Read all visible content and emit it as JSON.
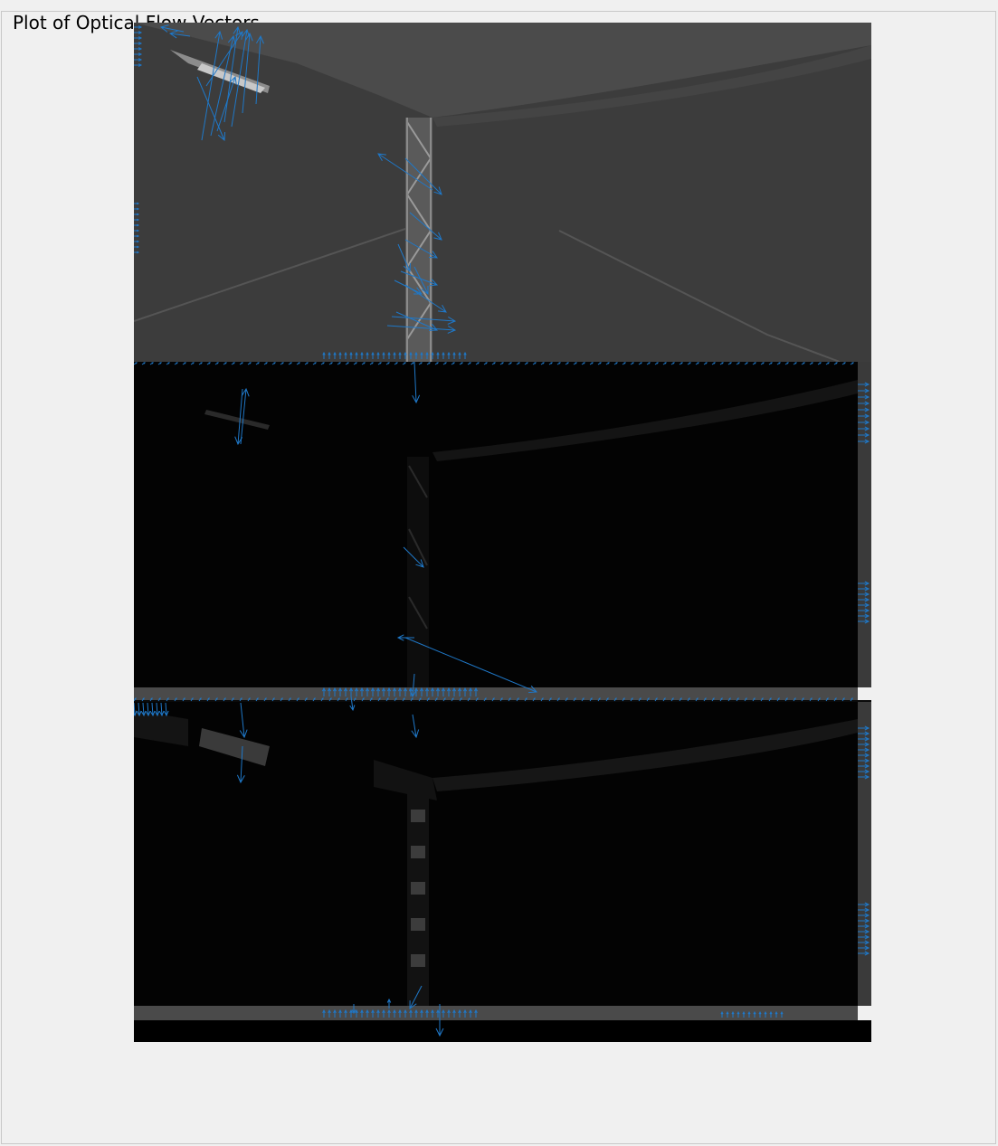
{
  "panel": {
    "title": "Plot of Optical Flow Vectors"
  },
  "colors": {
    "vector": "#1f78c8",
    "panel_background": "#f0f0f0",
    "frame_top_background": "#3c3c3c",
    "frame_dark_background": "#030303",
    "separator_band": "#4a4a4a"
  },
  "plot": {
    "image_frames": [
      "grayscale-frame",
      "magnitude-frame-1",
      "magnitude-frame-2"
    ],
    "vector_style": "quiver arrows"
  }
}
